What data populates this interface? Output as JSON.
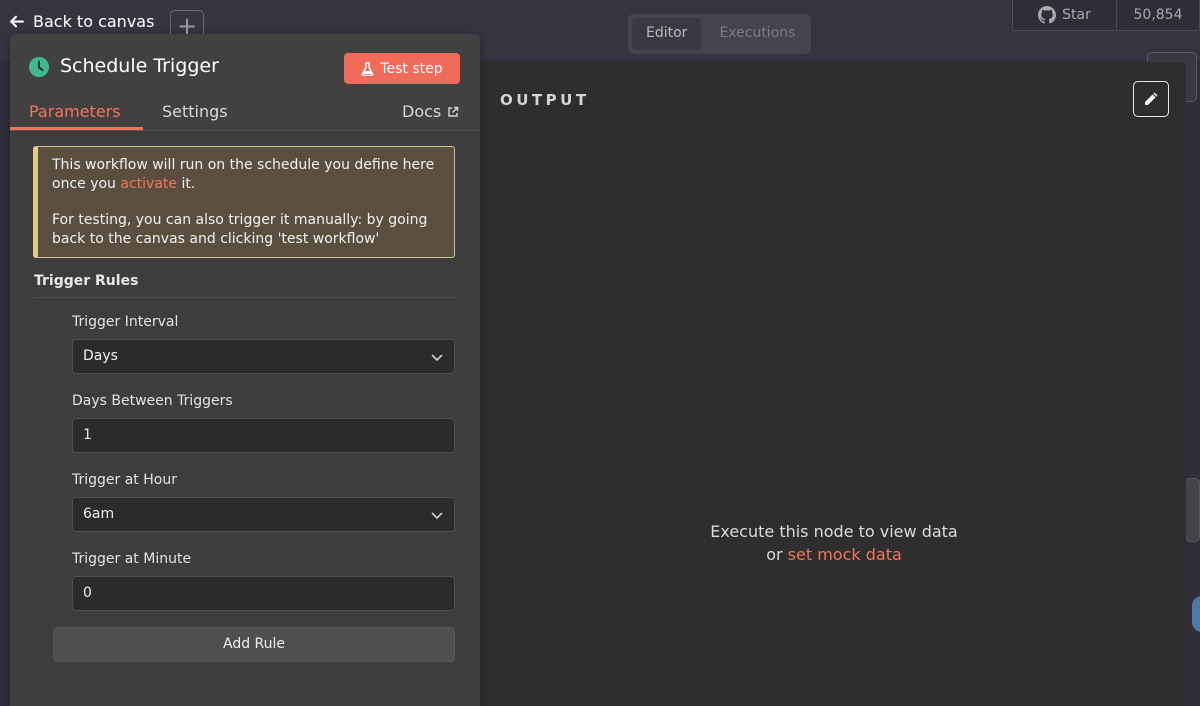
{
  "back": {
    "label": "Back to canvas"
  },
  "top_tabs": {
    "editor": "Editor",
    "executions": "Executions"
  },
  "github": {
    "star_label": "Star",
    "star_count": "50,854"
  },
  "node": {
    "title": "Schedule Trigger",
    "test_step_label": "Test step",
    "tabs": {
      "parameters": "Parameters",
      "settings": "Settings",
      "docs": "Docs"
    }
  },
  "notice": {
    "line1_pre": "This workflow will run on the schedule you define here once you ",
    "line1_link": "activate",
    "line1_post": " it.",
    "line2": "For testing, you can also trigger it manually: by going back to the canvas and clicking 'test workflow'"
  },
  "trigger_rules": {
    "title": "Trigger Rules",
    "interval": {
      "label": "Trigger Interval",
      "value": "Days"
    },
    "days_between": {
      "label": "Days Between Triggers",
      "value": "1"
    },
    "hour": {
      "label": "Trigger at Hour",
      "value": "6am"
    },
    "minute": {
      "label": "Trigger at Minute",
      "value": "0"
    },
    "add_rule_label": "Add Rule"
  },
  "output": {
    "title": "OUTPUT",
    "empty_line1": "Execute this node to view data",
    "empty_or": "or ",
    "empty_link": "set mock data"
  },
  "colors": {
    "accent": "#f16b5a",
    "schedule_icon": "#3dbb8f",
    "notice_border": "#e9c98b"
  }
}
